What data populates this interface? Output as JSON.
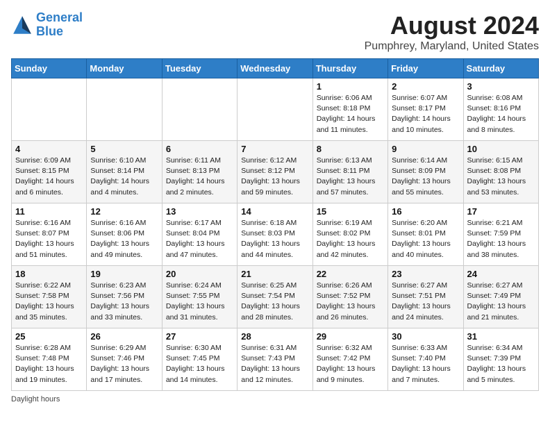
{
  "logo": {
    "line1": "General",
    "line2": "Blue"
  },
  "title": {
    "month_year": "August 2024",
    "location": "Pumphrey, Maryland, United States"
  },
  "days_of_week": [
    "Sunday",
    "Monday",
    "Tuesday",
    "Wednesday",
    "Thursday",
    "Friday",
    "Saturday"
  ],
  "footer": {
    "text": "Daylight hours"
  },
  "weeks": [
    [
      {
        "day": "",
        "sunrise": "",
        "sunset": "",
        "daylight": ""
      },
      {
        "day": "",
        "sunrise": "",
        "sunset": "",
        "daylight": ""
      },
      {
        "day": "",
        "sunrise": "",
        "sunset": "",
        "daylight": ""
      },
      {
        "day": "",
        "sunrise": "",
        "sunset": "",
        "daylight": ""
      },
      {
        "day": "1",
        "sunrise": "Sunrise: 6:06 AM",
        "sunset": "Sunset: 8:18 PM",
        "daylight": "Daylight: 14 hours and 11 minutes."
      },
      {
        "day": "2",
        "sunrise": "Sunrise: 6:07 AM",
        "sunset": "Sunset: 8:17 PM",
        "daylight": "Daylight: 14 hours and 10 minutes."
      },
      {
        "day": "3",
        "sunrise": "Sunrise: 6:08 AM",
        "sunset": "Sunset: 8:16 PM",
        "daylight": "Daylight: 14 hours and 8 minutes."
      }
    ],
    [
      {
        "day": "4",
        "sunrise": "Sunrise: 6:09 AM",
        "sunset": "Sunset: 8:15 PM",
        "daylight": "Daylight: 14 hours and 6 minutes."
      },
      {
        "day": "5",
        "sunrise": "Sunrise: 6:10 AM",
        "sunset": "Sunset: 8:14 PM",
        "daylight": "Daylight: 14 hours and 4 minutes."
      },
      {
        "day": "6",
        "sunrise": "Sunrise: 6:11 AM",
        "sunset": "Sunset: 8:13 PM",
        "daylight": "Daylight: 14 hours and 2 minutes."
      },
      {
        "day": "7",
        "sunrise": "Sunrise: 6:12 AM",
        "sunset": "Sunset: 8:12 PM",
        "daylight": "Daylight: 13 hours and 59 minutes."
      },
      {
        "day": "8",
        "sunrise": "Sunrise: 6:13 AM",
        "sunset": "Sunset: 8:11 PM",
        "daylight": "Daylight: 13 hours and 57 minutes."
      },
      {
        "day": "9",
        "sunrise": "Sunrise: 6:14 AM",
        "sunset": "Sunset: 8:09 PM",
        "daylight": "Daylight: 13 hours and 55 minutes."
      },
      {
        "day": "10",
        "sunrise": "Sunrise: 6:15 AM",
        "sunset": "Sunset: 8:08 PM",
        "daylight": "Daylight: 13 hours and 53 minutes."
      }
    ],
    [
      {
        "day": "11",
        "sunrise": "Sunrise: 6:16 AM",
        "sunset": "Sunset: 8:07 PM",
        "daylight": "Daylight: 13 hours and 51 minutes."
      },
      {
        "day": "12",
        "sunrise": "Sunrise: 6:16 AM",
        "sunset": "Sunset: 8:06 PM",
        "daylight": "Daylight: 13 hours and 49 minutes."
      },
      {
        "day": "13",
        "sunrise": "Sunrise: 6:17 AM",
        "sunset": "Sunset: 8:04 PM",
        "daylight": "Daylight: 13 hours and 47 minutes."
      },
      {
        "day": "14",
        "sunrise": "Sunrise: 6:18 AM",
        "sunset": "Sunset: 8:03 PM",
        "daylight": "Daylight: 13 hours and 44 minutes."
      },
      {
        "day": "15",
        "sunrise": "Sunrise: 6:19 AM",
        "sunset": "Sunset: 8:02 PM",
        "daylight": "Daylight: 13 hours and 42 minutes."
      },
      {
        "day": "16",
        "sunrise": "Sunrise: 6:20 AM",
        "sunset": "Sunset: 8:01 PM",
        "daylight": "Daylight: 13 hours and 40 minutes."
      },
      {
        "day": "17",
        "sunrise": "Sunrise: 6:21 AM",
        "sunset": "Sunset: 7:59 PM",
        "daylight": "Daylight: 13 hours and 38 minutes."
      }
    ],
    [
      {
        "day": "18",
        "sunrise": "Sunrise: 6:22 AM",
        "sunset": "Sunset: 7:58 PM",
        "daylight": "Daylight: 13 hours and 35 minutes."
      },
      {
        "day": "19",
        "sunrise": "Sunrise: 6:23 AM",
        "sunset": "Sunset: 7:56 PM",
        "daylight": "Daylight: 13 hours and 33 minutes."
      },
      {
        "day": "20",
        "sunrise": "Sunrise: 6:24 AM",
        "sunset": "Sunset: 7:55 PM",
        "daylight": "Daylight: 13 hours and 31 minutes."
      },
      {
        "day": "21",
        "sunrise": "Sunrise: 6:25 AM",
        "sunset": "Sunset: 7:54 PM",
        "daylight": "Daylight: 13 hours and 28 minutes."
      },
      {
        "day": "22",
        "sunrise": "Sunrise: 6:26 AM",
        "sunset": "Sunset: 7:52 PM",
        "daylight": "Daylight: 13 hours and 26 minutes."
      },
      {
        "day": "23",
        "sunrise": "Sunrise: 6:27 AM",
        "sunset": "Sunset: 7:51 PM",
        "daylight": "Daylight: 13 hours and 24 minutes."
      },
      {
        "day": "24",
        "sunrise": "Sunrise: 6:27 AM",
        "sunset": "Sunset: 7:49 PM",
        "daylight": "Daylight: 13 hours and 21 minutes."
      }
    ],
    [
      {
        "day": "25",
        "sunrise": "Sunrise: 6:28 AM",
        "sunset": "Sunset: 7:48 PM",
        "daylight": "Daylight: 13 hours and 19 minutes."
      },
      {
        "day": "26",
        "sunrise": "Sunrise: 6:29 AM",
        "sunset": "Sunset: 7:46 PM",
        "daylight": "Daylight: 13 hours and 17 minutes."
      },
      {
        "day": "27",
        "sunrise": "Sunrise: 6:30 AM",
        "sunset": "Sunset: 7:45 PM",
        "daylight": "Daylight: 13 hours and 14 minutes."
      },
      {
        "day": "28",
        "sunrise": "Sunrise: 6:31 AM",
        "sunset": "Sunset: 7:43 PM",
        "daylight": "Daylight: 13 hours and 12 minutes."
      },
      {
        "day": "29",
        "sunrise": "Sunrise: 6:32 AM",
        "sunset": "Sunset: 7:42 PM",
        "daylight": "Daylight: 13 hours and 9 minutes."
      },
      {
        "day": "30",
        "sunrise": "Sunrise: 6:33 AM",
        "sunset": "Sunset: 7:40 PM",
        "daylight": "Daylight: 13 hours and 7 minutes."
      },
      {
        "day": "31",
        "sunrise": "Sunrise: 6:34 AM",
        "sunset": "Sunset: 7:39 PM",
        "daylight": "Daylight: 13 hours and 5 minutes."
      }
    ]
  ]
}
